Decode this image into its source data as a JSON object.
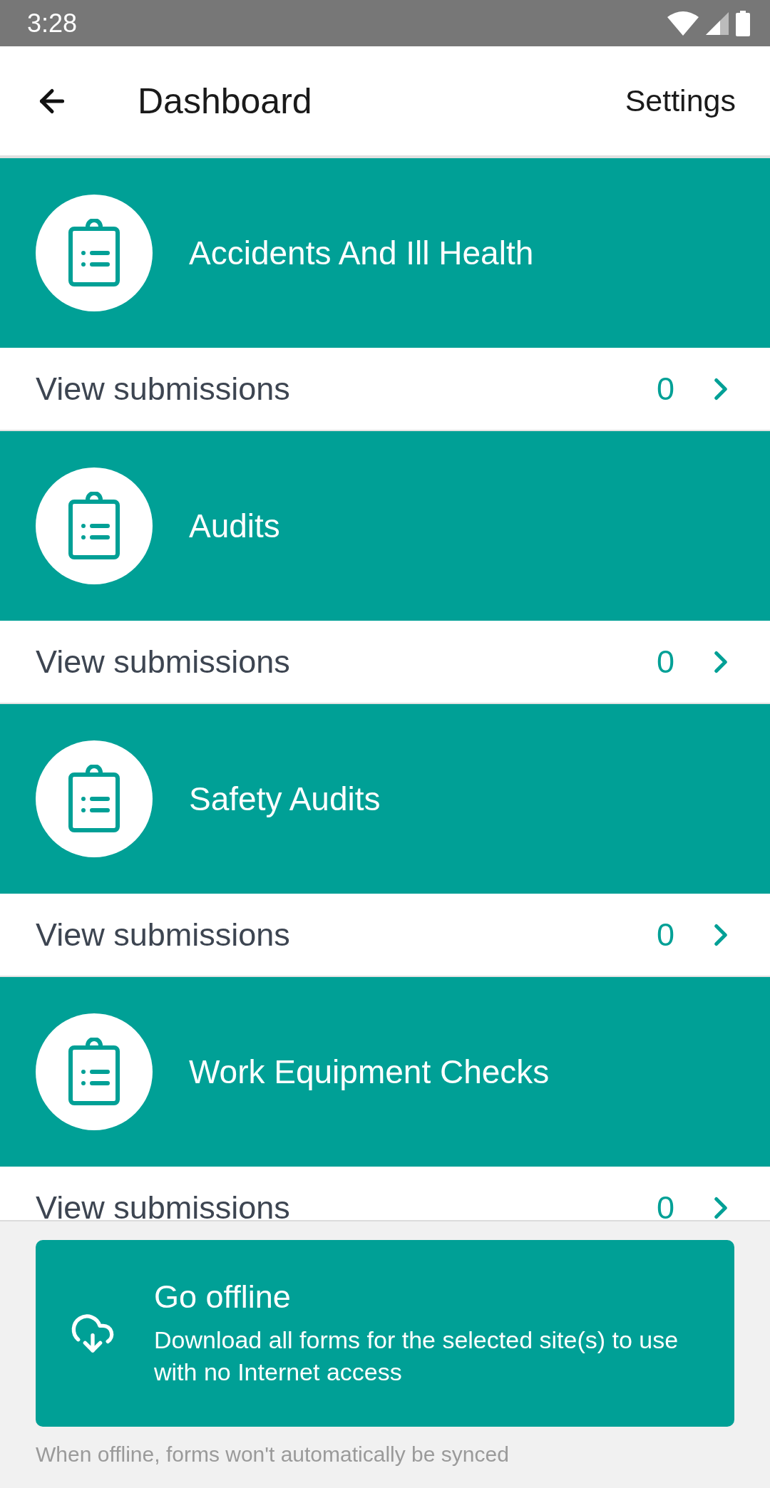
{
  "status_bar": {
    "time": "3:28"
  },
  "header": {
    "title": "Dashboard",
    "action": "Settings"
  },
  "forms": [
    {
      "title": "Accidents And Ill Health",
      "link": "View submissions",
      "count": "0"
    },
    {
      "title": "Audits",
      "link": "View submissions",
      "count": "0"
    },
    {
      "title": "Safety Audits",
      "link": "View submissions",
      "count": "0"
    },
    {
      "title": "Work Equipment Checks",
      "link": "View submissions",
      "count": "0"
    }
  ],
  "offline_card": {
    "title": "Go offline",
    "description": "Download all forms for the selected site(s) to use with no Internet access"
  },
  "footer_note": "When offline, forms won't automatically be synced"
}
